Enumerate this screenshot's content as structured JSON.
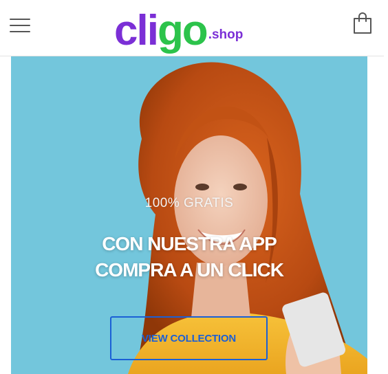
{
  "header": {
    "logo": {
      "main_prefix": "cli",
      "main_accent": "go",
      "tld": ".shop"
    },
    "menu_icon": "hamburger-menu-icon",
    "cart_icon": "shopping-bag-icon"
  },
  "hero": {
    "kicker": "100% GRATIS",
    "title_line1": "CON NUESTRA APP",
    "title_line2": "COMPRA A UN CLICK",
    "button_label": "VIEW COLLECTION"
  },
  "colors": {
    "brand_purple": "#7b2fd6",
    "brand_green": "#2cc34b",
    "hero_background": "#73c6dc",
    "button_blue": "#1a5fd6"
  }
}
